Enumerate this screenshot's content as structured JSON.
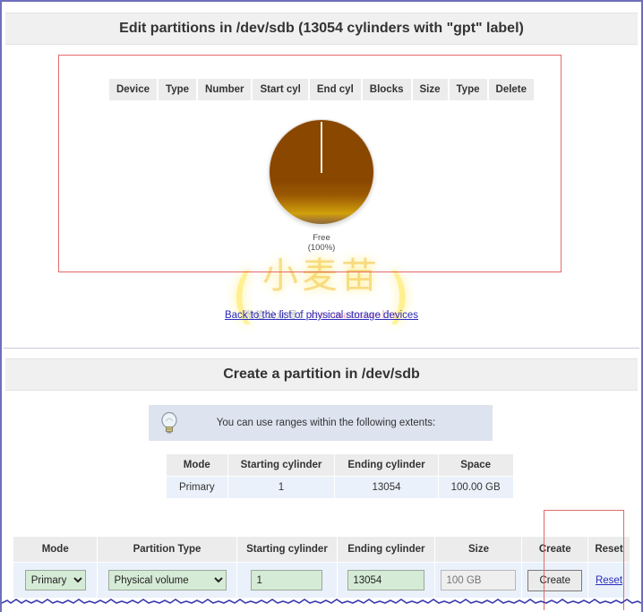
{
  "edit_section": {
    "title": "Edit partitions in /dev/sdb (13054 cylinders with \"gpt\" label)",
    "table_headers": [
      "Device",
      "Type",
      "Number",
      "Start cyl",
      "End cyl",
      "Blocks",
      "Size",
      "Type",
      "Delete"
    ],
    "back_link": "Back to the list of physical storage devices"
  },
  "chart_data": {
    "type": "pie",
    "title": "",
    "categories": [
      "Free"
    ],
    "values": [
      100
    ],
    "labels": [
      "Free",
      "(100%)"
    ],
    "label_line1": "Free",
    "label_line2": "(100%)",
    "colors": [
      "#8a4700"
    ],
    "legend": "none"
  },
  "watermark": {
    "main": "小麦苗",
    "paren_left": "(",
    "paren_right": ")",
    "sub_cn": "微信公众号：",
    "sub_id": "xiaomaimiaolhr"
  },
  "create_section": {
    "title_prefix": "Create a ",
    "title_highlight": "partition in ",
    "title_suffix": "/dev/sdb",
    "title_full": "Create a partition in /dev/sdb",
    "tip_text": "You can use ranges within the following extents:",
    "tip_icon": "lightbulb-icon",
    "extents": {
      "headers": [
        "Mode",
        "Starting cylinder",
        "Ending cylinder",
        "Space"
      ],
      "rows": [
        [
          "Primary",
          "1",
          "13054",
          "100.00 GB"
        ]
      ]
    },
    "form": {
      "headers": [
        "Mode",
        "Partition Type",
        "Starting cylinder",
        "Ending cylinder",
        "Size",
        "Create",
        "Reset"
      ],
      "mode_value": "Primary",
      "mode_options": [
        "Primary"
      ],
      "ptype_value": "Physical volume",
      "ptype_options": [
        "Physical volume"
      ],
      "start_cyl_value": "1",
      "end_cyl_value": "13054",
      "size_placeholder": "100 GB",
      "size_value": "",
      "create_label": "Create",
      "reset_label": "Reset"
    }
  },
  "colors": {
    "accent_link": "#2b2bbb",
    "annotation": "#e36a6a",
    "pie_fill": "#8a4700",
    "field_green": "#d6ebd6",
    "row_blue": "#eaf1fa",
    "header_gray": "#ececec",
    "frame": "#6f6fbe"
  }
}
